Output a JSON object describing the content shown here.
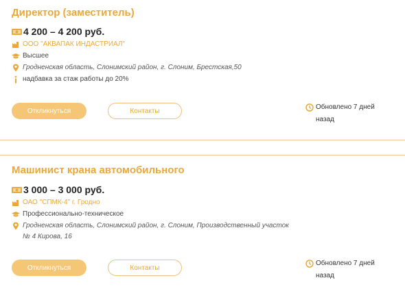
{
  "colors": {
    "accent": "#e8a93a",
    "button_fill": "#f6c677",
    "divider": "#f0c890"
  },
  "vacancies": [
    {
      "title": "Директор (заместитель)",
      "salary": "4 200 – 4 200 руб.",
      "company": "ООО \"АКВАПАК ИНДАСТРИАЛ\"",
      "education": "Высшее",
      "address": "Гродненская область, Слонимский район, г. Слоним, Брестская,50",
      "info": "надбавка за стаж работы до 20%",
      "apply_label": "Откликнуться",
      "contacts_label": "Контакты",
      "updated": "Обновлено 7 дней назад"
    },
    {
      "title": "Машинист крана автомобильного",
      "salary": "3 000 – 3 000 руб.",
      "company": "ОАО \"СПМК-4\" г. Гродно",
      "education": "Профессионально-техническое",
      "address": "Гродненская область, Слонимский район, г. Слоним, Производственный участок № 4 Кирова, 16",
      "apply_label": "Откликнуться",
      "contacts_label": "Контакты",
      "updated": "Обновлено 7 дней назад"
    }
  ],
  "icons": {
    "salary": "money-icon",
    "company": "building-icon",
    "education": "graduation-cap-icon",
    "address": "location-pin-icon",
    "info": "info-icon",
    "updated": "clock-icon"
  }
}
